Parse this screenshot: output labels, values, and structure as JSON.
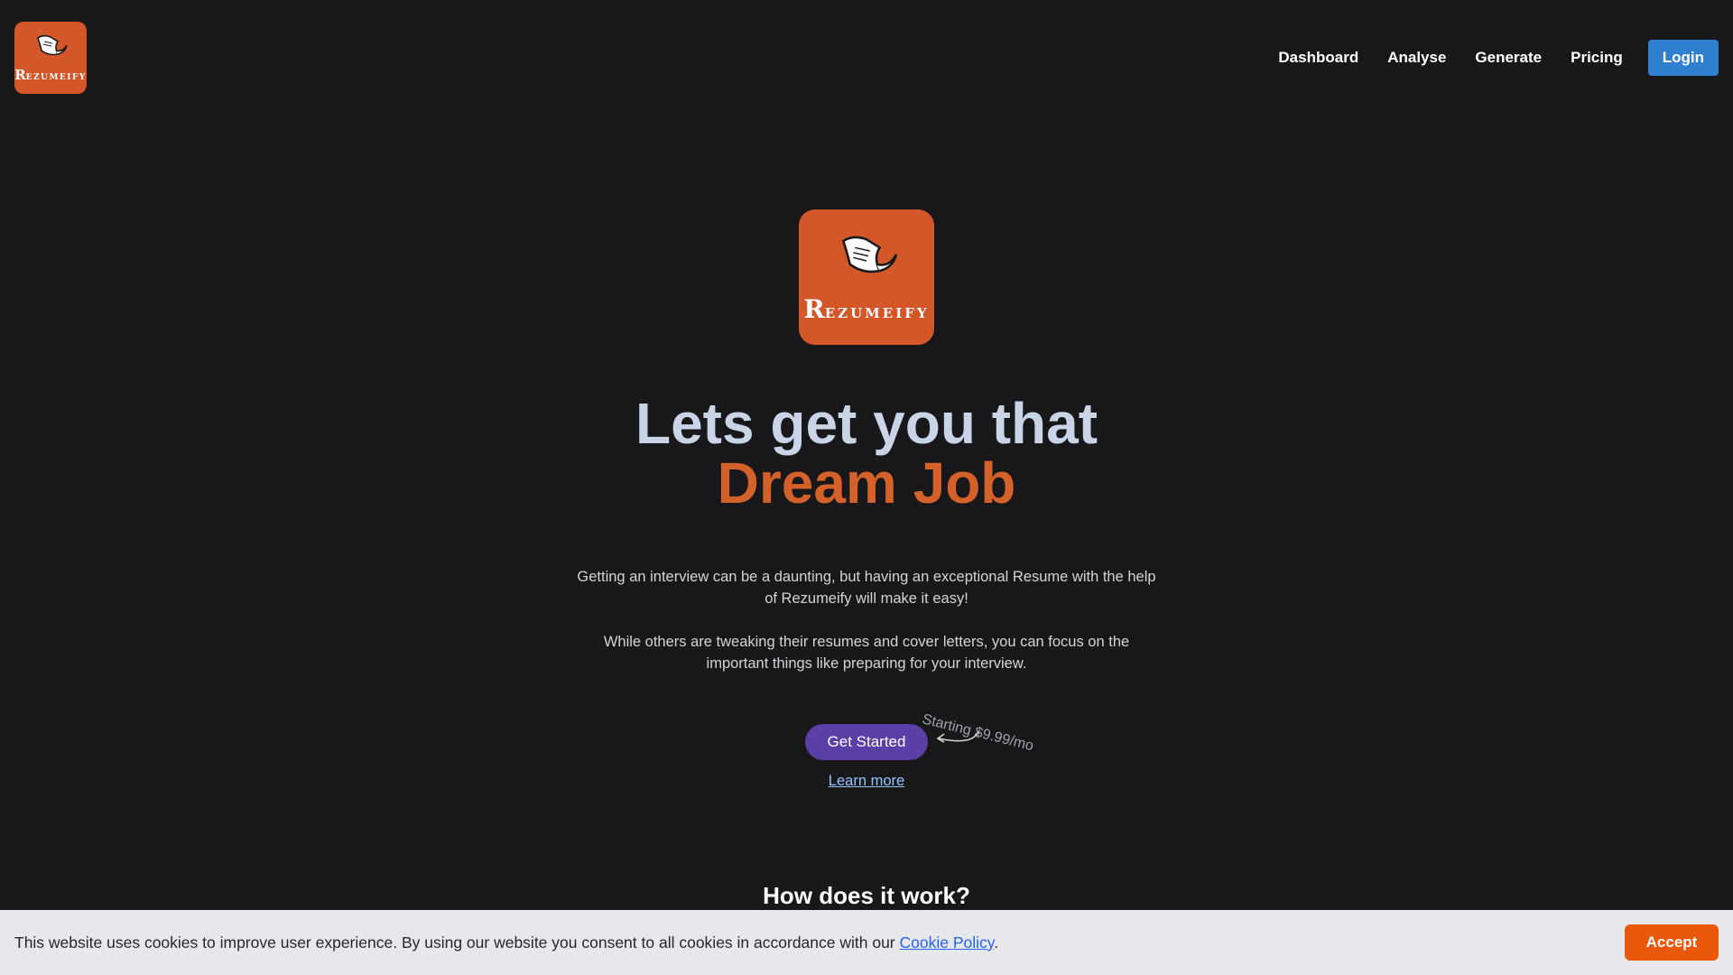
{
  "header": {
    "logo": {
      "wordmark_initial": "R",
      "wordmark_rest": "EZUMEIFY"
    },
    "nav": {
      "dashboard": "Dashboard",
      "analyse": "Analyse",
      "generate": "Generate",
      "pricing": "Pricing"
    },
    "login_label": "Login"
  },
  "hero": {
    "logo": {
      "wordmark_initial": "R",
      "wordmark_rest": "EZUMEIFY"
    },
    "headline_line1": "Lets get you that",
    "headline_line2": "Dream Job",
    "paragraph1": "Getting an interview can be a daunting, but having an exceptional Resume with the help of Rezumeify will make it easy!",
    "paragraph2": "While others are tweaking their resumes and cover letters, you can focus on the important things like preparing for your interview.",
    "cta_label": "Get Started",
    "price_note": "Starting $9.99/mo",
    "learn_more": "Learn more"
  },
  "section": {
    "how_title": "How does it work?"
  },
  "cookie_banner": {
    "text_before": "This website uses cookies to improve user experience. By using our website you consent to all cookies in accordance with our ",
    "link_text": "Cookie Policy",
    "text_after": ".",
    "accept_label": "Accept"
  },
  "colors": {
    "background": "#18181b",
    "brand_orange": "#d4572a",
    "login_blue": "#2f80d1",
    "cta_purple": "#5b3fa6",
    "accept_orange": "#ea580c"
  },
  "icons": {
    "logo_mark": "paper-scroll-icon",
    "price_arrow": "curved-arrow-icon"
  }
}
